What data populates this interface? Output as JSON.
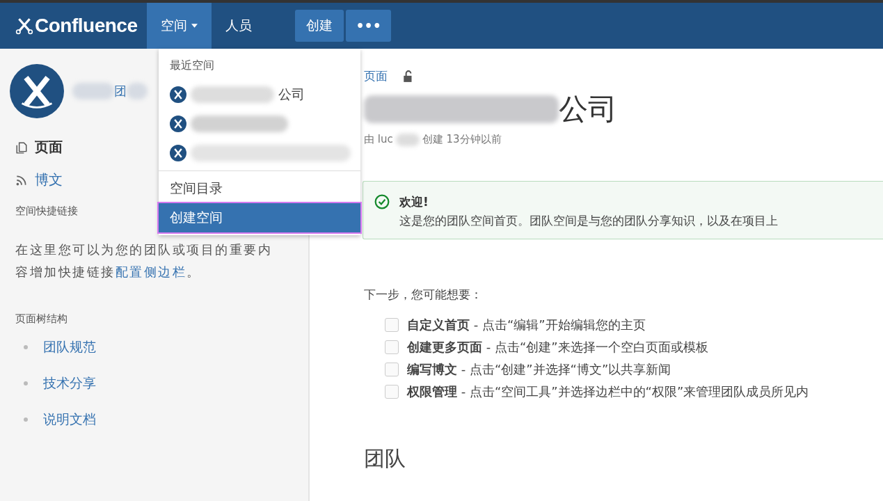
{
  "header": {
    "logo": "Confluence",
    "nav": [
      {
        "label": "空间",
        "selected": true,
        "dropdown": true
      },
      {
        "label": "人员",
        "selected": false,
        "dropdown": false
      }
    ],
    "create_button": "创建",
    "more_button": "•••"
  },
  "dropdown": {
    "section_title": "最近空间",
    "recent_spaces": [
      {
        "blurred": true,
        "visible_text": "公司"
      },
      {
        "blurred": true
      },
      {
        "blurred": true
      }
    ],
    "items": [
      {
        "label": "空间目录",
        "selected": false
      },
      {
        "label": "创建空间",
        "selected": true
      }
    ]
  },
  "sidebar": {
    "space_name_visible": "团",
    "nav": [
      {
        "label": "页面",
        "kind": "pages",
        "selected": true
      },
      {
        "label": "博文",
        "kind": "blog",
        "selected": false
      }
    ],
    "shortcuts_title": "空间快捷链接",
    "shortcuts_text": "在这里您可以为您的团队或项目的重要内容增加快捷链接",
    "shortcuts_link": "配置侧边栏",
    "shortcuts_end": "。",
    "tree_title": "页面树结构",
    "tree": [
      {
        "label": "团队规范"
      },
      {
        "label": "技术分享"
      },
      {
        "label": "说明文档"
      }
    ]
  },
  "page": {
    "breadcrumb": "页面",
    "title_visible": "公司",
    "meta_author": "由 luc",
    "meta_rest": "创建 13分钟以前",
    "welcome_title": "欢迎!",
    "welcome_text": "这是您的团队空间首页。团队空间是与您的团队分享知识，以及在项目上",
    "next_title": "下一步，您可能想要：",
    "tasks": [
      {
        "title": "自定义首页",
        "text": " - 点击“编辑”开始编辑您的主页",
        "checked": false
      },
      {
        "title": "创建更多页面",
        "text": " - 点击“创建”来选择一个空白页面或模板",
        "checked": false
      },
      {
        "title": "编写博文",
        "text": " - 点击“创建”并选择“博文”以共享新闻",
        "checked": false
      },
      {
        "title": "权限管理",
        "text": " - 点击“空间工具”并选择边栏中的“权限”来管理团队成员所见内",
        "checked": false
      }
    ],
    "team_title": "团队"
  }
}
